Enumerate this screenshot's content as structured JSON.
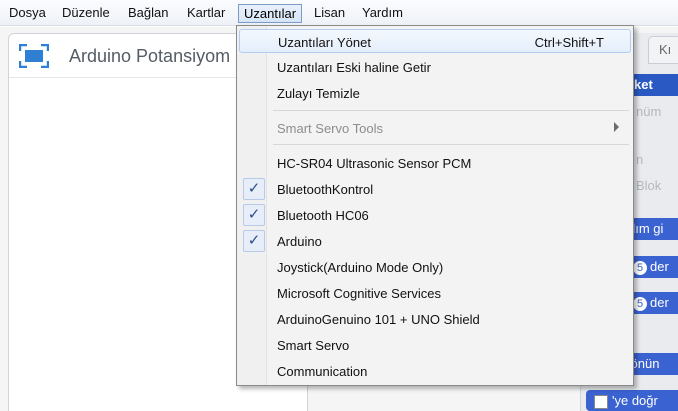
{
  "menubar": {
    "items": [
      "Dosya",
      "Düzenle",
      "Bağlan",
      "Kartlar",
      "Uzantılar",
      "Lisan",
      "Yardım"
    ],
    "active_index": 4
  },
  "project": {
    "title": "Arduino Potansiyom"
  },
  "right_panel": {
    "tab_label": "Kı",
    "selected_category": "ket",
    "categories": [
      "nüm",
      "n",
      "Blok"
    ],
    "blocks": [
      "dım gi",
      "der",
      "der",
      "yönün",
      "'ye doğr"
    ],
    "block_numbers": [
      "5",
      "5"
    ]
  },
  "dropdown": {
    "items": [
      {
        "label": "Uzantıları Yönet",
        "shortcut": "Ctrl+Shift+T"
      },
      {
        "label": "Uzantıları Eski haline Getir"
      },
      {
        "label": "Zulayı Temizle"
      },
      {
        "label": "Smart Servo Tools"
      },
      {
        "label": "HC-SR04 Ultrasonic Sensor PCM"
      },
      {
        "label": "BluetoothKontrol"
      },
      {
        "label": "Bluetooth HC06"
      },
      {
        "label": "Arduino"
      },
      {
        "label": "Joystick(Arduino Mode Only)"
      },
      {
        "label": "Microsoft Cognitive Services"
      },
      {
        "label": "ArduinoGenuino 101 + UNO Shield"
      },
      {
        "label": "Smart Servo"
      },
      {
        "label": "Communication"
      }
    ],
    "check_glyph": "✓"
  },
  "colors": {
    "accent": "#2b59c3",
    "block_blue": "#3a62d0",
    "menu_bg": "#f3f3f3"
  }
}
